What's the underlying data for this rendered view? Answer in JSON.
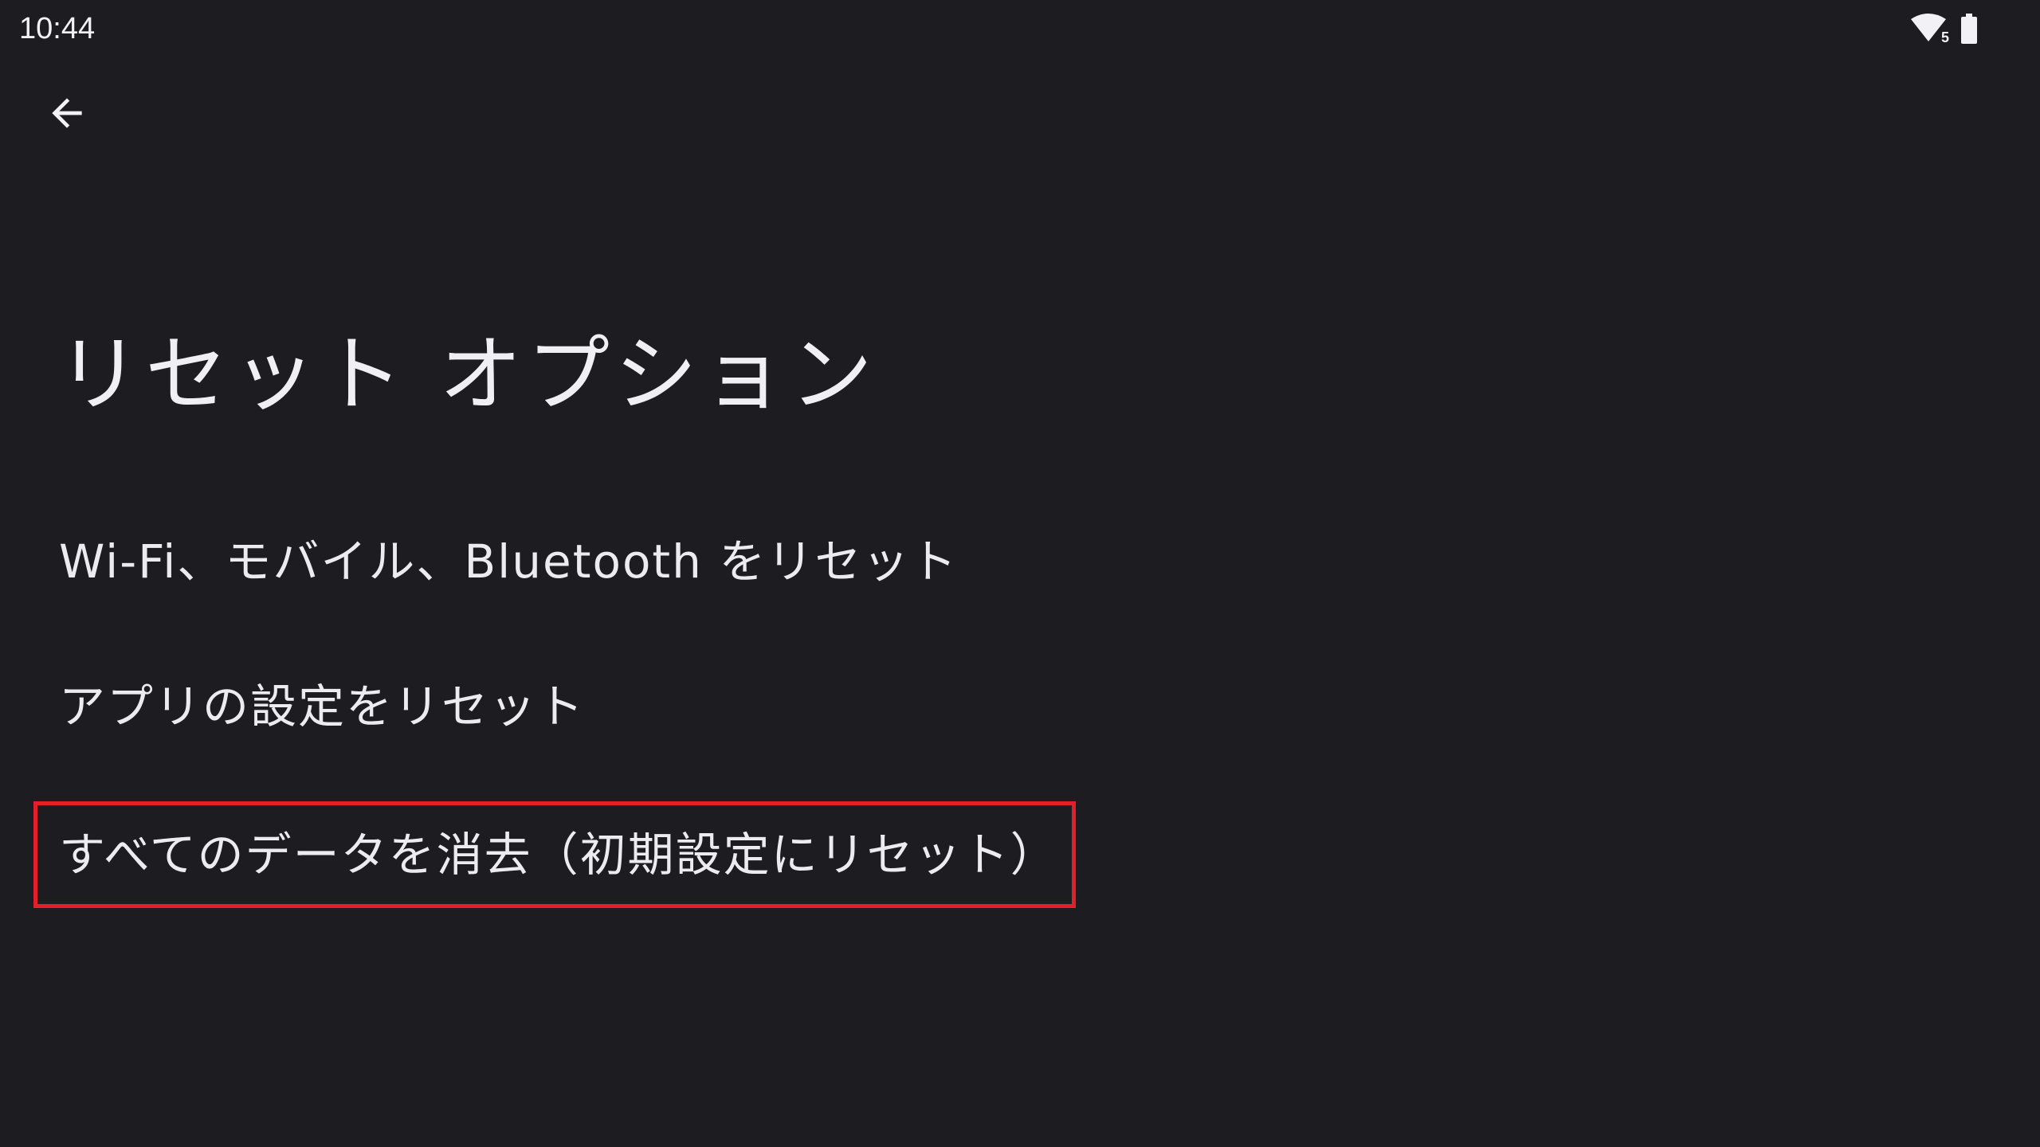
{
  "status_bar": {
    "time": "10:44",
    "wifi_badge": "5",
    "icons": [
      "wifi-icon",
      "battery-icon"
    ]
  },
  "toolbar": {
    "back_icon": "arrow-back-icon"
  },
  "page": {
    "title": "リセット オプション"
  },
  "menu": {
    "items": [
      {
        "label": "Wi-Fi、モバイル、Bluetooth をリセット"
      },
      {
        "label": "アプリの設定をリセット"
      },
      {
        "label": "すべてのデータを消去（初期設定にリセット）",
        "highlighted": true
      }
    ]
  },
  "colors": {
    "background": "#1d1c21",
    "text": "#ecebf0",
    "highlight_border": "#e3202a"
  }
}
